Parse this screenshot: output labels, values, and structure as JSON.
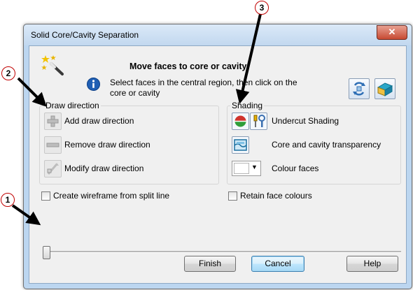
{
  "window": {
    "title": "Solid Core/Cavity Separation",
    "close_glyph": "✕"
  },
  "header": {
    "heading": "Move faces to core or cavity",
    "instructions": "Select faces in the central region, then click on the core or cavity",
    "wand_icon": "magic-wand-icon",
    "info_icon": "info-icon",
    "tool_buttons": [
      {
        "name": "swap-core-cavity-icon"
      },
      {
        "name": "separate-view-icon"
      }
    ]
  },
  "draw_direction": {
    "legend": "Draw direction",
    "items": [
      {
        "label": "Add draw direction",
        "icon": "add-direction-icon"
      },
      {
        "label": "Remove draw direction",
        "icon": "remove-direction-icon"
      },
      {
        "label": "Modify draw direction",
        "icon": "modify-direction-icon"
      }
    ]
  },
  "shading": {
    "legend": "Shading",
    "undercut_label": "Undercut Shading",
    "transparency_label": "Core and cavity transparency",
    "colour_faces_label": "Colour faces",
    "colour_swatch": "#ffffff"
  },
  "options": {
    "wireframe_label": "Create wireframe from split line",
    "wireframe_checked": false,
    "retain_label": "Retain face colours",
    "retain_checked": false
  },
  "slider": {
    "value": 0
  },
  "buttons": {
    "finish": "Finish",
    "cancel": "Cancel",
    "help": "Help"
  },
  "callouts": [
    "1",
    "2",
    "3"
  ],
  "colors": {
    "callout_border": "#c00000",
    "accent_blue": "#1f5fb4"
  }
}
